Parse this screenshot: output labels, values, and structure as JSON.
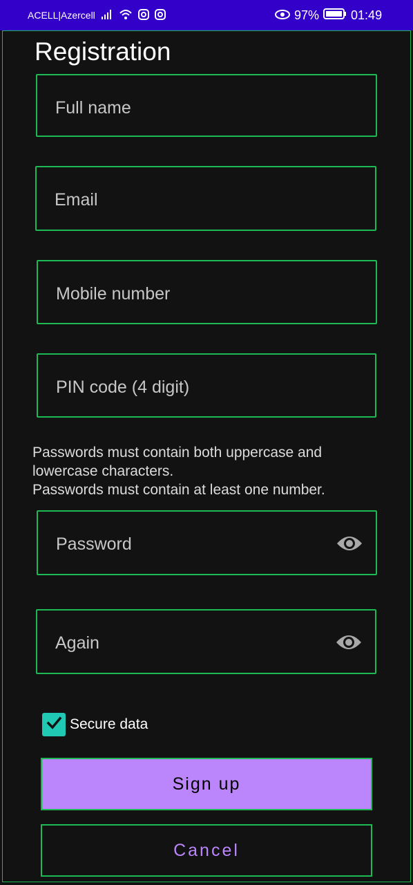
{
  "status_bar": {
    "carrier": "ACELL|Azercell",
    "battery": "97%",
    "time": "01:49"
  },
  "page": {
    "title": "Registration"
  },
  "fields": {
    "full_name_placeholder": "Full name",
    "email_placeholder": "Email",
    "mobile_placeholder": "Mobile number",
    "pin_placeholder": "PIN code (4 digit)",
    "password_placeholder": "Password",
    "again_placeholder": "Again"
  },
  "hint": {
    "text": "Passwords must contain both uppercase and\nlowercase characters.\nPasswords must contain at least one number."
  },
  "secure": {
    "label": "Secure data",
    "checked": true
  },
  "buttons": {
    "signup": "Sign up",
    "cancel": "Cancel"
  },
  "colors": {
    "status_bar": "#3200c8",
    "background": "#121212",
    "accent": "#bb86fc",
    "checkbox": "#20c9b4"
  },
  "icons": [
    "signal-icon",
    "wifi-icon",
    "instagram-icon",
    "eye-status-icon",
    "battery-icon",
    "visibility-icon",
    "check-icon"
  ]
}
